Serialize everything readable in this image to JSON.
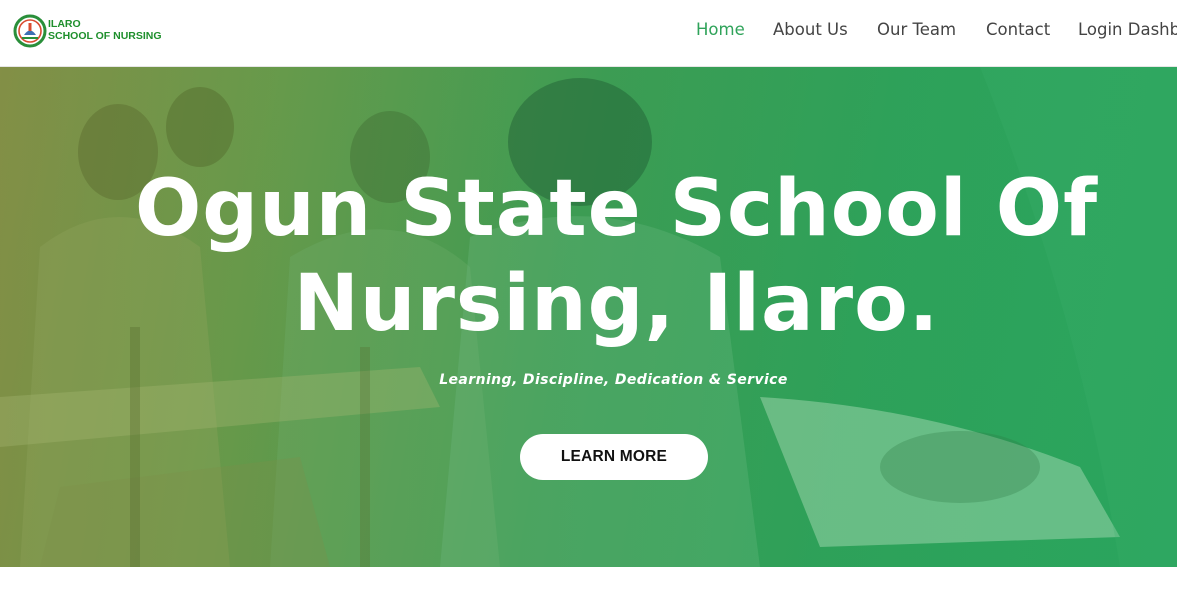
{
  "header": {
    "logo": {
      "line1": "ILARO",
      "line2": "SCHOOL OF NURSING",
      "icon": "school-emblem-icon"
    },
    "nav": [
      {
        "label": "Home",
        "active": true
      },
      {
        "label": "About Us",
        "active": false
      },
      {
        "label": "Our Team",
        "active": false
      },
      {
        "label": "Contact",
        "active": false
      },
      {
        "label": "Login Dashb",
        "active": false
      }
    ]
  },
  "hero": {
    "title_line1": "Ogun State School Of",
    "title_line2": "Nursing, Ilaro.",
    "tagline": "Learning, Discipline, Dedication & Service",
    "button_label": "LEARN MORE",
    "overlay_color": "#2ea25a"
  },
  "colors": {
    "brand_green": "#1e8f2c",
    "nav_active": "#2fa35a",
    "nav_text": "#444444"
  }
}
